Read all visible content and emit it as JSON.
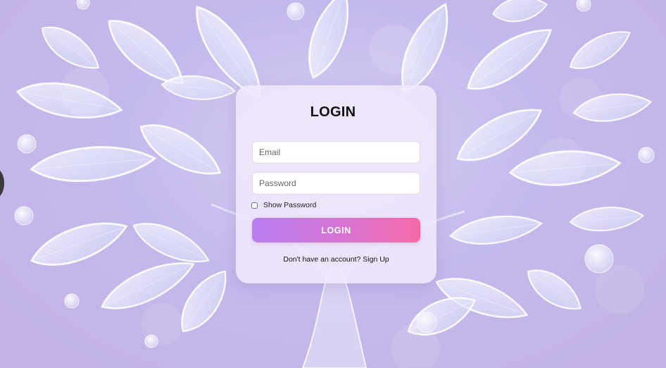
{
  "login": {
    "title": "LOGIN",
    "email_placeholder": "Email",
    "password_placeholder": "Password",
    "show_password_label": "Show Password",
    "submit_label": "LOGIN",
    "signup_prompt": "Don't have an account?",
    "signup_link": "Sign Up"
  },
  "colors": {
    "background": "#c4b9ec",
    "card": "#f0e8fd",
    "button_start": "#b77ef0",
    "button_end": "#f46aa6",
    "leaf_fill": "#e9edfb",
    "leaf_stroke": "#ffffff"
  },
  "background": {
    "icon": "tree-leaves-illustration"
  }
}
